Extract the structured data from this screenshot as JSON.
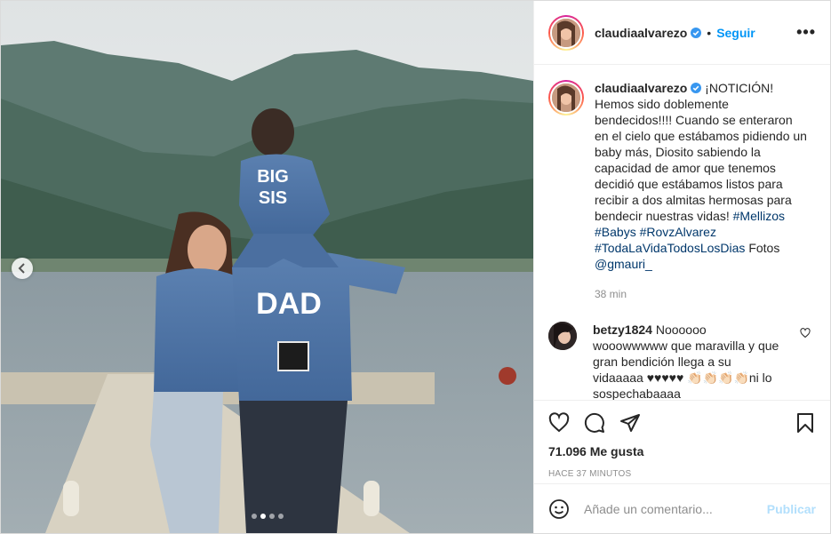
{
  "post": {
    "username": "claudiaalvarezo",
    "follow_label": "Seguir",
    "more_label": "•••",
    "bullet": "•"
  },
  "media": {
    "jacket_text_child": "BIG SIS",
    "jacket_text_child_line1": "BIG",
    "jacket_text_child_line2": "SIS",
    "jacket_text_dad": "DAD"
  },
  "caption": {
    "username": "claudiaalvarezo",
    "text": " ¡NOTICIÓN! Hemos sido doblemente bendecidos!!!! Cuando se enteraron en el cielo que estábamos pidiendo un baby más, Diosito sabiendo la capacidad de amor que tenemos decidió que estábamos listos para recibir a dos almitas hermosas para bendecir nuestras vidas! ",
    "hashtags": [
      "#Mellizos",
      "#Babys",
      "#RovzAlvarez",
      "#TodaLaVidaTodosLosDias"
    ],
    "photos_prefix": "Fotos ",
    "photos_mention": "@gmauri_",
    "time": "38 min"
  },
  "comments": [
    {
      "username": "betzy1824",
      "text": " Noooooo wooowwwww que maravilla y que gran bendición llega a su vidaaaaa ♥♥♥♥♥ 👏🏻👏🏻👏🏻👏🏻ni lo sospechabaaaa"
    }
  ],
  "actions": {
    "likes": "71.096 Me gusta",
    "ago": "HACE 37 MINUTOS"
  },
  "add_comment": {
    "placeholder": "Añade un comentario...",
    "publish_label": "Publicar"
  },
  "colors": {
    "follow": "#0095f6",
    "hashtag": "#00376b",
    "publish_disabled": "#b2dffc",
    "muted": "#8e8e8e"
  }
}
